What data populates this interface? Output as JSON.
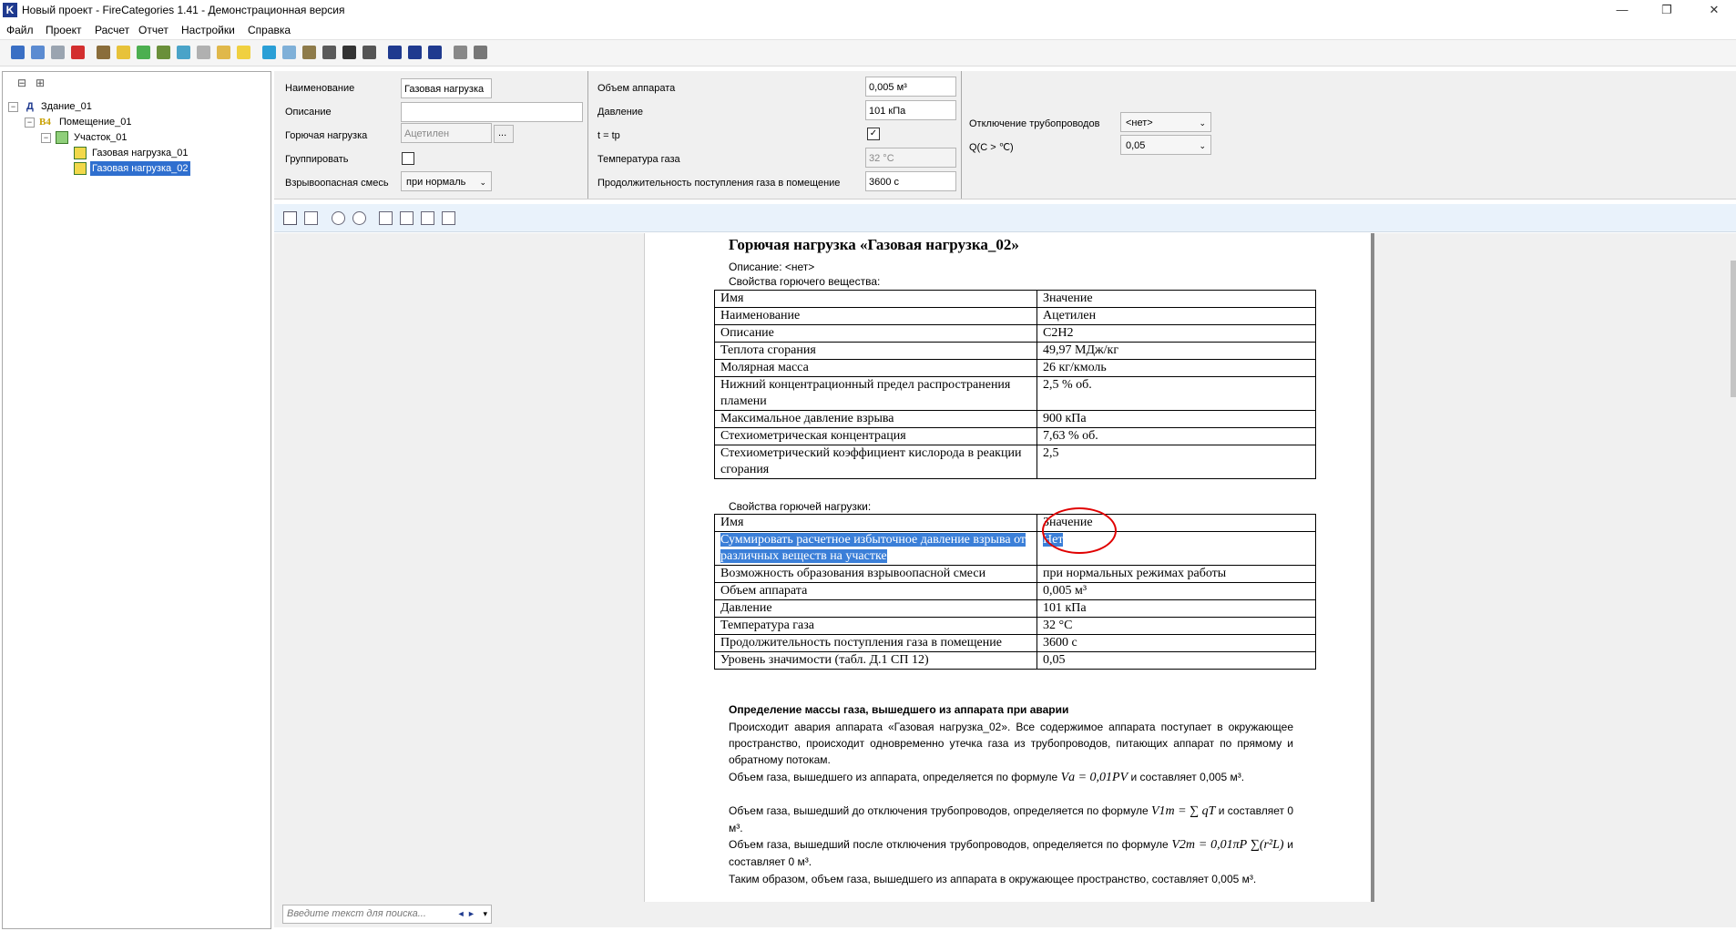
{
  "window": {
    "app_letter": "K",
    "title": "Новый проект - FireCategories 1.41 - Демонстрационная версия",
    "minimize": "—",
    "restore": "❐",
    "close": "✕"
  },
  "menu": [
    "Файл",
    "Проект",
    "Расчет",
    "Отчет",
    "Настройки",
    "Справка"
  ],
  "toolbar_icons": [
    "new-project-icon",
    "open-icon",
    "save-icon",
    "delete-icon",
    "building-icon",
    "room-icon",
    "area-icon",
    "load-icon",
    "fluid-icon",
    "dust-icon",
    "gas-icon",
    "light-icon",
    "water-icon",
    "fan-icon",
    "pipe-icon",
    "tank-icon",
    "bolt-icon",
    "stack-icon",
    "play-icon",
    "fast-forward-icon",
    "search-icon",
    "report-icon",
    "list-icon"
  ],
  "tree": {
    "collapse_all": "⊟",
    "expand_all": "⊞",
    "nodes": [
      {
        "label": "Здание_01",
        "badge": "Д"
      },
      {
        "label": "Помещение_01",
        "badge": "В4"
      },
      {
        "label": "Участок_01"
      },
      {
        "label": "Газовая нагрузка_01"
      },
      {
        "label": "Газовая нагрузка_02"
      }
    ]
  },
  "props": {
    "name_label": "Наименование",
    "name_value": "Газовая нагрузка",
    "desc_label": "Описание",
    "desc_value": "",
    "fuel_label": "Горючая нагрузка",
    "fuel_value": "Ацетилен",
    "fuel_browse": "...",
    "group_label": "Группировать",
    "group_checked": false,
    "mix_label": "Взрывоопасная смесь",
    "mix_value": "при нормаль",
    "volume_label": "Объем аппарата",
    "volume_value": "0,005 м³",
    "pressure_label": "Давление",
    "pressure_value": "101 кПа",
    "t_label": "t = tр",
    "t_mark": "✓",
    "gas_temp_label": "Температура газа",
    "gas_temp_value": "32 °C",
    "duration_label": "Продолжительность поступления газа в помещение",
    "duration_value": "3600 с",
    "pipe_label": "Отключение трубопроводов",
    "pipe_value": "<нет>",
    "q_label": "Q(C > ℃)",
    "q_value": "0,05"
  },
  "report": {
    "heading": "Горючая нагрузка «Газовая нагрузка_02»",
    "description": "Описание: <нет>",
    "substance_caption": "Свойства горючего вещества:",
    "substance_rows": [
      [
        "Имя",
        "Значение"
      ],
      [
        "Наименование",
        "Ацетилен"
      ],
      [
        "Описание",
        "C2H2"
      ],
      [
        "Теплота сгорания",
        "49,97 МДж/кг"
      ],
      [
        "Молярная масса",
        "26 кг/кмоль"
      ],
      [
        "Нижний концентрационный предел распространения пламени",
        "2,5 % об."
      ],
      [
        "Максимальное давление взрыва",
        "900 кПа"
      ],
      [
        "Стехиометрическая концентрация",
        "7,63 % об."
      ],
      [
        "Стехиометрический коэффициент кислорода в реакции сгорания",
        "2,5"
      ]
    ],
    "load_caption": "Свойства горючей нагрузки:",
    "load_rows": [
      [
        "Имя",
        "Значение"
      ],
      [
        "Суммировать расчетное избыточное давление взрыва от различных веществ на участке",
        "Нет"
      ],
      [
        "Возможность образования взрывоопасной смеси",
        "при нормальных режимах работы"
      ],
      [
        "Объем аппарата",
        "0,005 м³"
      ],
      [
        "Давление",
        "101 кПа"
      ],
      [
        "Температура газа",
        "32 °C"
      ],
      [
        "Продолжительность поступления газа в помещение",
        "3600 с"
      ],
      [
        "Уровень значимости (табл. Д.1 СП 12)",
        "0,05"
      ]
    ],
    "mass_heading": "Определение массы газа, вышедшего из аппарата при аварии",
    "p1": "Происходит авария аппарата «Газовая нагрузка_02». Все содержимое аппарата поступает в окружающее пространство, происходит одновременно утечка газа из трубопроводов, питающих аппарат по прямому и обратному потокам.",
    "p2_pre": "Объем газа, вышедшего из аппарата, определяется по формуле ",
    "p2_formula": "Vа = 0,01PV",
    "p2_post": " и составляет 0,005 м³.",
    "p3_pre": "Объем газа, вышедший до отключения трубопроводов, определяется по формуле ",
    "p3_formula": "V1т = ∑ qT",
    "p3_post": " и составляет 0 м³.",
    "p4_pre": "Объем газа, вышедший после отключения трубопроводов, определяется по формуле ",
    "p4_formula": "V2т = 0,01πP ∑(r²L)",
    "p4_post": " и составляет 0 м³.",
    "p5": "Таким образом, объем газа, вышедшего из аппарата в окружающее пространство, составляет 0,005 м³."
  },
  "search": {
    "placeholder": "Введите текст для поиска...",
    "prev": "◄",
    "next": "►",
    "menu": "▾"
  },
  "colors": {
    "selection": "#3b7fd8",
    "annotation": "#e00000",
    "tree_selected": "#2f6fcf"
  }
}
